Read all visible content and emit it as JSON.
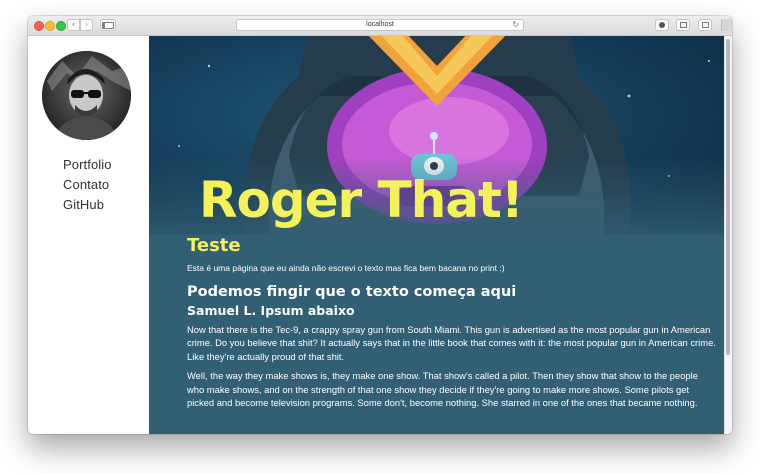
{
  "browser": {
    "address": "localhost",
    "back_glyph": "‹",
    "forward_glyph": "›",
    "reload_glyph": "↻"
  },
  "sidebar": {
    "avatar_icon": "profile-photo",
    "links": [
      {
        "label": "Portfolio"
      },
      {
        "label": "Contato"
      },
      {
        "label": "GitHub"
      }
    ]
  },
  "hero": {
    "title": "Roger That!"
  },
  "article": {
    "heading": "Teste",
    "intro": "Esta é uma página que eu ainda não escrevi o texto mas fica bem bacana no print :)",
    "subheading": "Podemos fingir que o texto começa aqui",
    "subsubheading": "Samuel L. Ipsum abaixo",
    "paragraphs": [
      "Now that there is the Tec-9, a crappy spray gun from South Miami. This gun is advertised as the most popular gun in American crime. Do you believe that shit? It actually says that in the little book that comes with it: the most popular gun in American crime. Like they're actually proud of that shit.",
      "Well, the way they make shows is, they make one show. That show's called a pilot. Then they show that show to the people who make shows, and on the strength of that one show they decide if they're going to make more shows. Some pilots get picked and become television programs. Some don't, become nothing. She starred in one of the ones that became nothing."
    ]
  },
  "colors": {
    "accent": "#f4f25a",
    "content_bg": "#315f73",
    "sidebar_bg": "#ffffff"
  }
}
